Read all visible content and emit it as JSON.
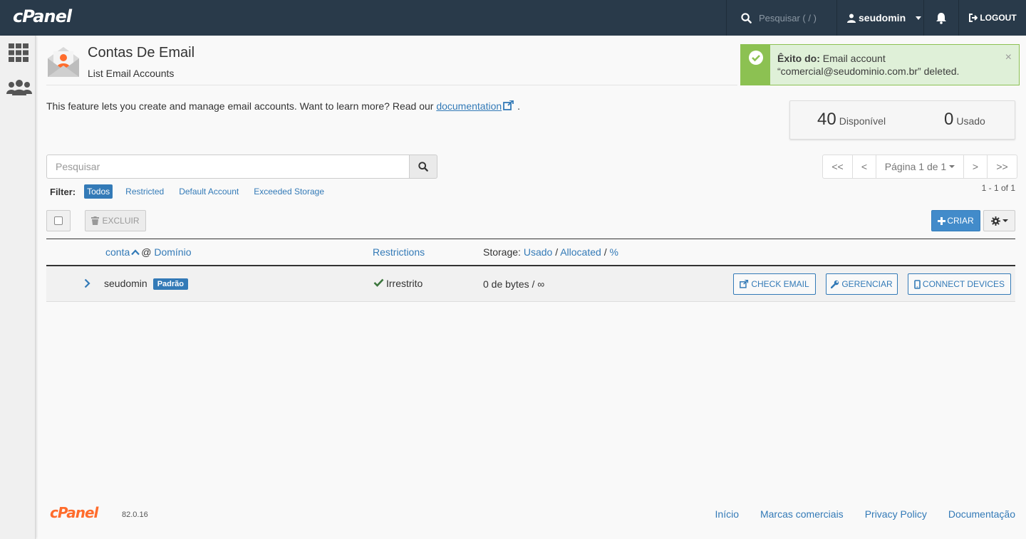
{
  "topbar": {
    "logo": "cPanel",
    "search_placeholder": "Pesquisar ( / )",
    "username": "seudomin",
    "logout_label": "LOGOUT"
  },
  "page": {
    "title": "Contas De Email",
    "subtitle": "List Email Accounts",
    "intro_text": "This feature lets you create and manage email accounts. Want to learn more? Read our",
    "intro_link": "documentation",
    "intro_end": "."
  },
  "alert": {
    "title": "Êxito do:",
    "message_line1": "Email account",
    "message_line2": "“comercial@seudominio.com.br” deleted.",
    "close": "×"
  },
  "stats": {
    "available_count": "40",
    "available_label": "Disponível",
    "used_count": "0",
    "used_label": "Usado"
  },
  "search": {
    "placeholder": "Pesquisar"
  },
  "pagination": {
    "first": "<<",
    "prev": "<",
    "page_label": "Página 1 de 1",
    "next": ">",
    "last": ">>",
    "range": "1 - 1 of 1"
  },
  "filters": {
    "label": "Filter:",
    "items": [
      "Todos",
      "Restricted",
      "Default Account",
      "Exceeded Storage"
    ],
    "active": "Todos"
  },
  "toolbar": {
    "delete_label": "EXCLUIR",
    "create_label": "CRIAR"
  },
  "table": {
    "headers": {
      "account": "conta",
      "at": "@",
      "domain": "Domínio",
      "restrictions": "Restrictions",
      "storage_prefix": "Storage:",
      "storage_used": "Usado",
      "sep1": "/",
      "storage_allocated": "Allocated",
      "sep2": "/",
      "storage_percent": "%"
    },
    "rows": [
      {
        "account": "seudomin",
        "badge": "Padrão",
        "restriction": "Irrestrito",
        "storage": "0 de bytes / ∞",
        "actions": [
          "CHECK EMAIL",
          "GERENCIAR",
          "CONNECT DEVICES"
        ]
      }
    ]
  },
  "footer": {
    "logo": "cPanel",
    "version": "82.0.16",
    "links": [
      "Início",
      "Marcas comerciais",
      "Privacy Policy",
      "Documentação"
    ]
  },
  "colors": {
    "topbar": "#293a4a",
    "link": "#337ab7",
    "success": "#8cc152",
    "brand_orange": "#ff6c2c"
  }
}
